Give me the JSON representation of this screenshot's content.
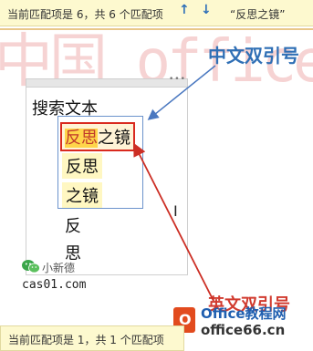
{
  "find_bar_top": {
    "status": "当前匹配项是 6，共 6 个匹配项",
    "up_arrow": "↑",
    "down_arrow": "↓",
    "query": "“反思之镜”"
  },
  "watermark": {
    "text": "中国 office教程"
  },
  "panel": {
    "heading": "搜索文本",
    "grip_dots": "•••",
    "results": [
      {
        "highlight": "反思",
        "rest": "之镜"
      },
      {
        "text": "反思"
      },
      {
        "text": "之镜"
      }
    ],
    "line4": "反",
    "line5": "思"
  },
  "cursor_glyph": "I",
  "wechat": {
    "name": "小新德"
  },
  "site": "cas01.com",
  "annotations": {
    "chinese_quote": "中文双引号",
    "english_quote": "英文双引号"
  },
  "logo": {
    "letter": "O",
    "line1": "Office教程网",
    "line2": "office66.cn"
  },
  "find_bar_bottom": {
    "status": "当前匹配项是 1，共 1 个匹配项"
  },
  "colors": {
    "annotation_blue": "#2f6fb5",
    "annotation_red": "#d13b2f",
    "bar_bg": "#fdf9cf"
  },
  "icons": [
    "up-arrow-icon",
    "down-arrow-icon",
    "wechat-icon",
    "office-logo-icon"
  ]
}
